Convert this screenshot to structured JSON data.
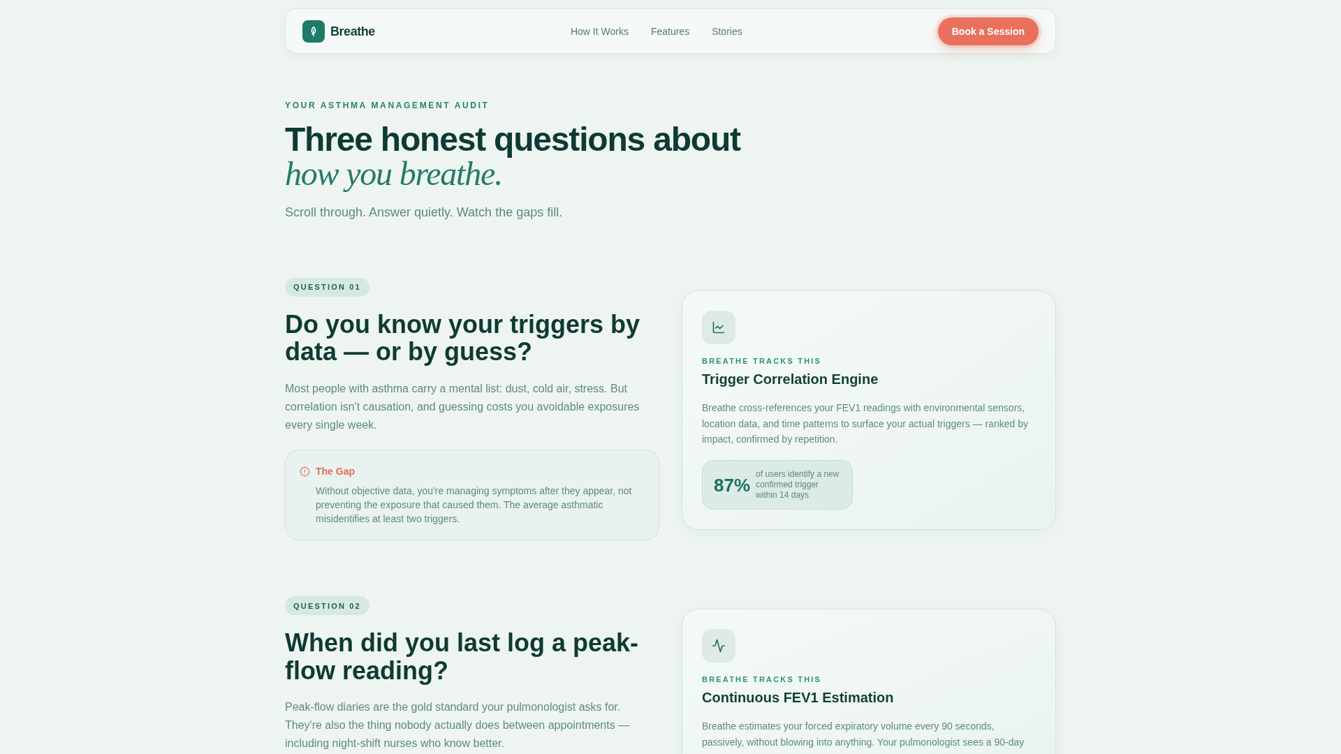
{
  "nav": {
    "brand": "Breathe",
    "links": [
      {
        "label": "How It Works"
      },
      {
        "label": "Features"
      },
      {
        "label": "Stories"
      }
    ],
    "cta": "Book a Session"
  },
  "hero": {
    "eyebrow": "YOUR ASTHMA MANAGEMENT AUDIT",
    "title": "Three honest questions about",
    "title_accent": "how you breathe.",
    "subtitle": "Scroll through. Answer quietly. Watch the gaps fill."
  },
  "questions": [
    {
      "badge": "QUESTION 01",
      "heading": "Do you know your triggers by data — or by guess?",
      "body": "Most people with asthma carry a mental list: dust, cold air, stress. But correlation isn't causation, and guessing costs you avoidable exposures every single week.",
      "callout": {
        "title": "The Gap",
        "text": "Without objective data, you're managing symptoms after they appear, not preventing the exposure that caused them. The average asthmatic misidentifies at least two triggers."
      },
      "feature": {
        "kind": "chart",
        "eyebrow": "BREATHE TRACKS THIS",
        "title": "Trigger Correlation Engine",
        "description": "Breathe cross-references your FEV1 readings with environmental sensors, location data, and time patterns to surface your actual triggers — ranked by impact, confirmed by repetition.",
        "stat": {
          "value": "87%",
          "caption": "of users identify a new confirmed trigger within 14 days"
        }
      }
    },
    {
      "badge": "QUESTION 02",
      "heading": "When did you last log a peak-flow reading?",
      "body": "Peak-flow diaries are the gold standard your pulmonologist asks for. They're also the thing nobody actually does between appointments — including night-shift nurses who know better.",
      "feature": {
        "kind": "pulse",
        "eyebrow": "BREATHE TRACKS THIS",
        "title": "Continuous FEV1 Estimation",
        "description": "Breathe estimates your forced expiratory volume every 90 seconds, passively, without blowing into anything. Your pulmonologist sees a 90-day"
      }
    }
  ]
}
